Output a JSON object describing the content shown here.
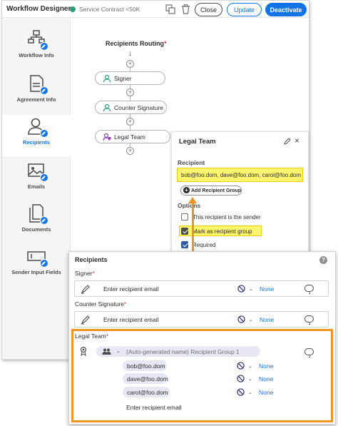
{
  "topbar": {
    "title": "Workflow Designer",
    "workflow_name": "Service Contract <50K",
    "status_color": "#2d9d78",
    "close_label": "Close",
    "update_label": "Update",
    "deactivate_label": "Deactivate"
  },
  "sidebar": {
    "items": [
      {
        "label": "Workflow Info",
        "icon": "workflow-icon"
      },
      {
        "label": "Agreement Info",
        "icon": "agreement-icon"
      },
      {
        "label": "Recipients",
        "icon": "recipients-icon",
        "active": true
      },
      {
        "label": "Emails",
        "icon": "emails-icon"
      },
      {
        "label": "Documents",
        "icon": "documents-icon"
      },
      {
        "label": "Sender Input Fields",
        "icon": "input-fields-icon"
      }
    ]
  },
  "routing": {
    "title": "Recipients Routing",
    "required_mark": "*",
    "nodes": [
      "Signer",
      "Counter Signature",
      "Legal Team"
    ]
  },
  "legal_panel": {
    "title": "Legal Team",
    "recipient_label": "Recipient",
    "recipient_value": "bob@foo.dom, dave@foo.dom, carol@foo.dom",
    "add_group_label": "Add Recipient Group",
    "options_label": "Options",
    "options": [
      {
        "label": "This recipient is the sender",
        "checked": false
      },
      {
        "label": "Mark as recipient group",
        "checked": true
      },
      {
        "label": "Required",
        "checked": true
      }
    ]
  },
  "recipients_panel": {
    "title": "Recipients",
    "help": "?",
    "required_mark": "*",
    "signer_label": "Signer",
    "counter_label": "Counter Signature",
    "legal_label": "Legal Team",
    "placeholder": "Enter recipient email",
    "none_label": "None",
    "group_name": "(Auto-generated name) Recipient Group 1",
    "group_emails": [
      "bob@foo.dom",
      "dave@foo.dom",
      "carol@foo.dom"
    ],
    "highlight_color": "#f29423",
    "accent_color": "#1473e6"
  }
}
